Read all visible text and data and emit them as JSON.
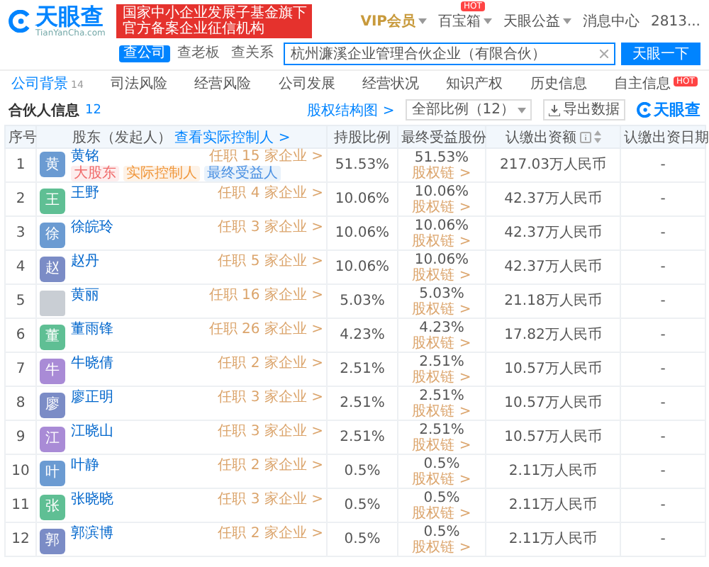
{
  "header": {
    "logo": {
      "name": "天眼查",
      "domain": "TianYanCha.com"
    },
    "banner": [
      "国家中小企业发展子基金旗下",
      "官方备案企业征信机构"
    ],
    "nav": [
      {
        "label": "VIP会员",
        "kind": "vip",
        "dropdown": true
      },
      {
        "label": "百宝箱",
        "kind": "plain",
        "dropdown": true,
        "badge": "HOT"
      },
      {
        "label": "天眼公益",
        "kind": "plain",
        "dropdown": true
      },
      {
        "label": "消息中心",
        "kind": "plain",
        "dropdown": false
      },
      {
        "label": "2813...",
        "kind": "plain",
        "dropdown": false
      }
    ],
    "search": {
      "tabs": [
        {
          "label": "查公司",
          "selected": true
        },
        {
          "label": "查老板",
          "selected": false
        },
        {
          "label": "查关系",
          "selected": false
        }
      ],
      "value": "杭州濂溪企业管理合伙企业（有限合伙）",
      "button": "天眼一下"
    }
  },
  "tabs": [
    {
      "label": "公司背景",
      "count": "14",
      "selected": true
    },
    {
      "label": "司法风险",
      "selected": false
    },
    {
      "label": "经营风险",
      "selected": false
    },
    {
      "label": "公司发展",
      "selected": false
    },
    {
      "label": "经营状况",
      "selected": false
    },
    {
      "label": "知识产权",
      "selected": false
    },
    {
      "label": "历史信息",
      "selected": false
    },
    {
      "label": "自主信息",
      "badge": "HOT",
      "selected": false
    }
  ],
  "section": {
    "title": "合伙人信息",
    "count": "12",
    "structure_link": "股权结构图 >",
    "filter": "全部比例（12）",
    "export": "导出数据",
    "brand": "天眼查"
  },
  "table": {
    "columns": [
      {
        "label": "序号"
      },
      {
        "label": "股东（发起人）",
        "link": "查看实际控制人 >"
      },
      {
        "label": "持股比例"
      },
      {
        "label": "最终受益股份"
      },
      {
        "label": "认缴出资额",
        "sortable": true
      },
      {
        "label": "认缴出资日期"
      }
    ],
    "rows": [
      {
        "index": "1",
        "name": "黄铭",
        "avatar": {
          "kind": "letter",
          "text": "黄",
          "color": "#6b9bd2"
        },
        "tags": [
          {
            "label": "大股东",
            "color": "#f06b6b"
          },
          {
            "label": "实际控制人",
            "color": "#f0973c"
          },
          {
            "label": "最终受益人",
            "color": "#4a90e2"
          }
        ],
        "positions": "任职 15 家企业 >",
        "share": "51.53%",
        "final_share": "51.53%",
        "chain_link": "股权链 >",
        "capital": "217.03万人民币",
        "date": "-"
      },
      {
        "index": "2",
        "name": "王野",
        "avatar": {
          "kind": "letter",
          "text": "王",
          "color": "#5fbf94"
        },
        "positions": "任职 4 家企业 >",
        "share": "10.06%",
        "final_share": "10.06%",
        "chain_link": "股权链 >",
        "capital": "42.37万人民币",
        "date": "-"
      },
      {
        "index": "3",
        "name": "徐皖玲",
        "avatar": {
          "kind": "letter",
          "text": "徐",
          "color": "#6b9bd2"
        },
        "positions": "任职 3 家企业 >",
        "share": "10.06%",
        "final_share": "10.06%",
        "chain_link": "股权链 >",
        "capital": "42.37万人民币",
        "date": "-"
      },
      {
        "index": "4",
        "name": "赵丹",
        "avatar": {
          "kind": "letter",
          "text": "赵",
          "color": "#7b8cc6"
        },
        "positions": "任职 5 家企业 >",
        "share": "10.06%",
        "final_share": "10.06%",
        "chain_link": "股权链 >",
        "capital": "42.37万人民币",
        "date": "-"
      },
      {
        "index": "5",
        "name": "黄丽",
        "avatar": {
          "kind": "photo"
        },
        "positions": "任职 16 家企业 >",
        "share": "5.03%",
        "final_share": "5.03%",
        "chain_link": "股权链 >",
        "capital": "21.18万人民币",
        "date": "-"
      },
      {
        "index": "6",
        "name": "董雨锋",
        "avatar": {
          "kind": "letter",
          "text": "董",
          "color": "#5fbf94"
        },
        "positions": "任职 26 家企业 >",
        "share": "4.23%",
        "final_share": "4.23%",
        "chain_link": "股权链 >",
        "capital": "17.82万人民币",
        "date": "-"
      },
      {
        "index": "7",
        "name": "牛晓倩",
        "avatar": {
          "kind": "letter",
          "text": "牛",
          "color": "#a98bd6"
        },
        "positions": "任职 2 家企业 >",
        "share": "2.51%",
        "final_share": "2.51%",
        "chain_link": "股权链 >",
        "capital": "10.57万人民币",
        "date": "-"
      },
      {
        "index": "8",
        "name": "廖正明",
        "avatar": {
          "kind": "letter",
          "text": "廖",
          "color": "#7b8cc6"
        },
        "positions": "任职 3 家企业 >",
        "share": "2.51%",
        "final_share": "2.51%",
        "chain_link": "股权链 >",
        "capital": "10.57万人民币",
        "date": "-"
      },
      {
        "index": "9",
        "name": "江晓山",
        "avatar": {
          "kind": "letter",
          "text": "江",
          "color": "#a98bd6"
        },
        "positions": "任职 3 家企业 >",
        "share": "2.51%",
        "final_share": "2.51%",
        "chain_link": "股权链 >",
        "capital": "10.57万人民币",
        "date": "-"
      },
      {
        "index": "10",
        "name": "叶静",
        "avatar": {
          "kind": "letter",
          "text": "叶",
          "color": "#6b9bd2"
        },
        "positions": "任职 2 家企业 >",
        "share": "0.5%",
        "final_share": "0.5%",
        "chain_link": "股权链 >",
        "capital": "2.11万人民币",
        "date": "-"
      },
      {
        "index": "11",
        "name": "张晓晓",
        "avatar": {
          "kind": "letter",
          "text": "张",
          "color": "#5fbf94"
        },
        "positions": "任职 3 家企业 >",
        "share": "0.5%",
        "final_share": "0.5%",
        "chain_link": "股权链 >",
        "capital": "2.11万人民币",
        "date": "-"
      },
      {
        "index": "12",
        "name": "郭滨博",
        "avatar": {
          "kind": "letter",
          "text": "郭",
          "color": "#7b8cc6"
        },
        "positions": "任职 2 家企业 >",
        "share": "0.5%",
        "final_share": "0.5%",
        "chain_link": "股权链 >",
        "capital": "2.11万人民币",
        "date": "-"
      }
    ]
  }
}
